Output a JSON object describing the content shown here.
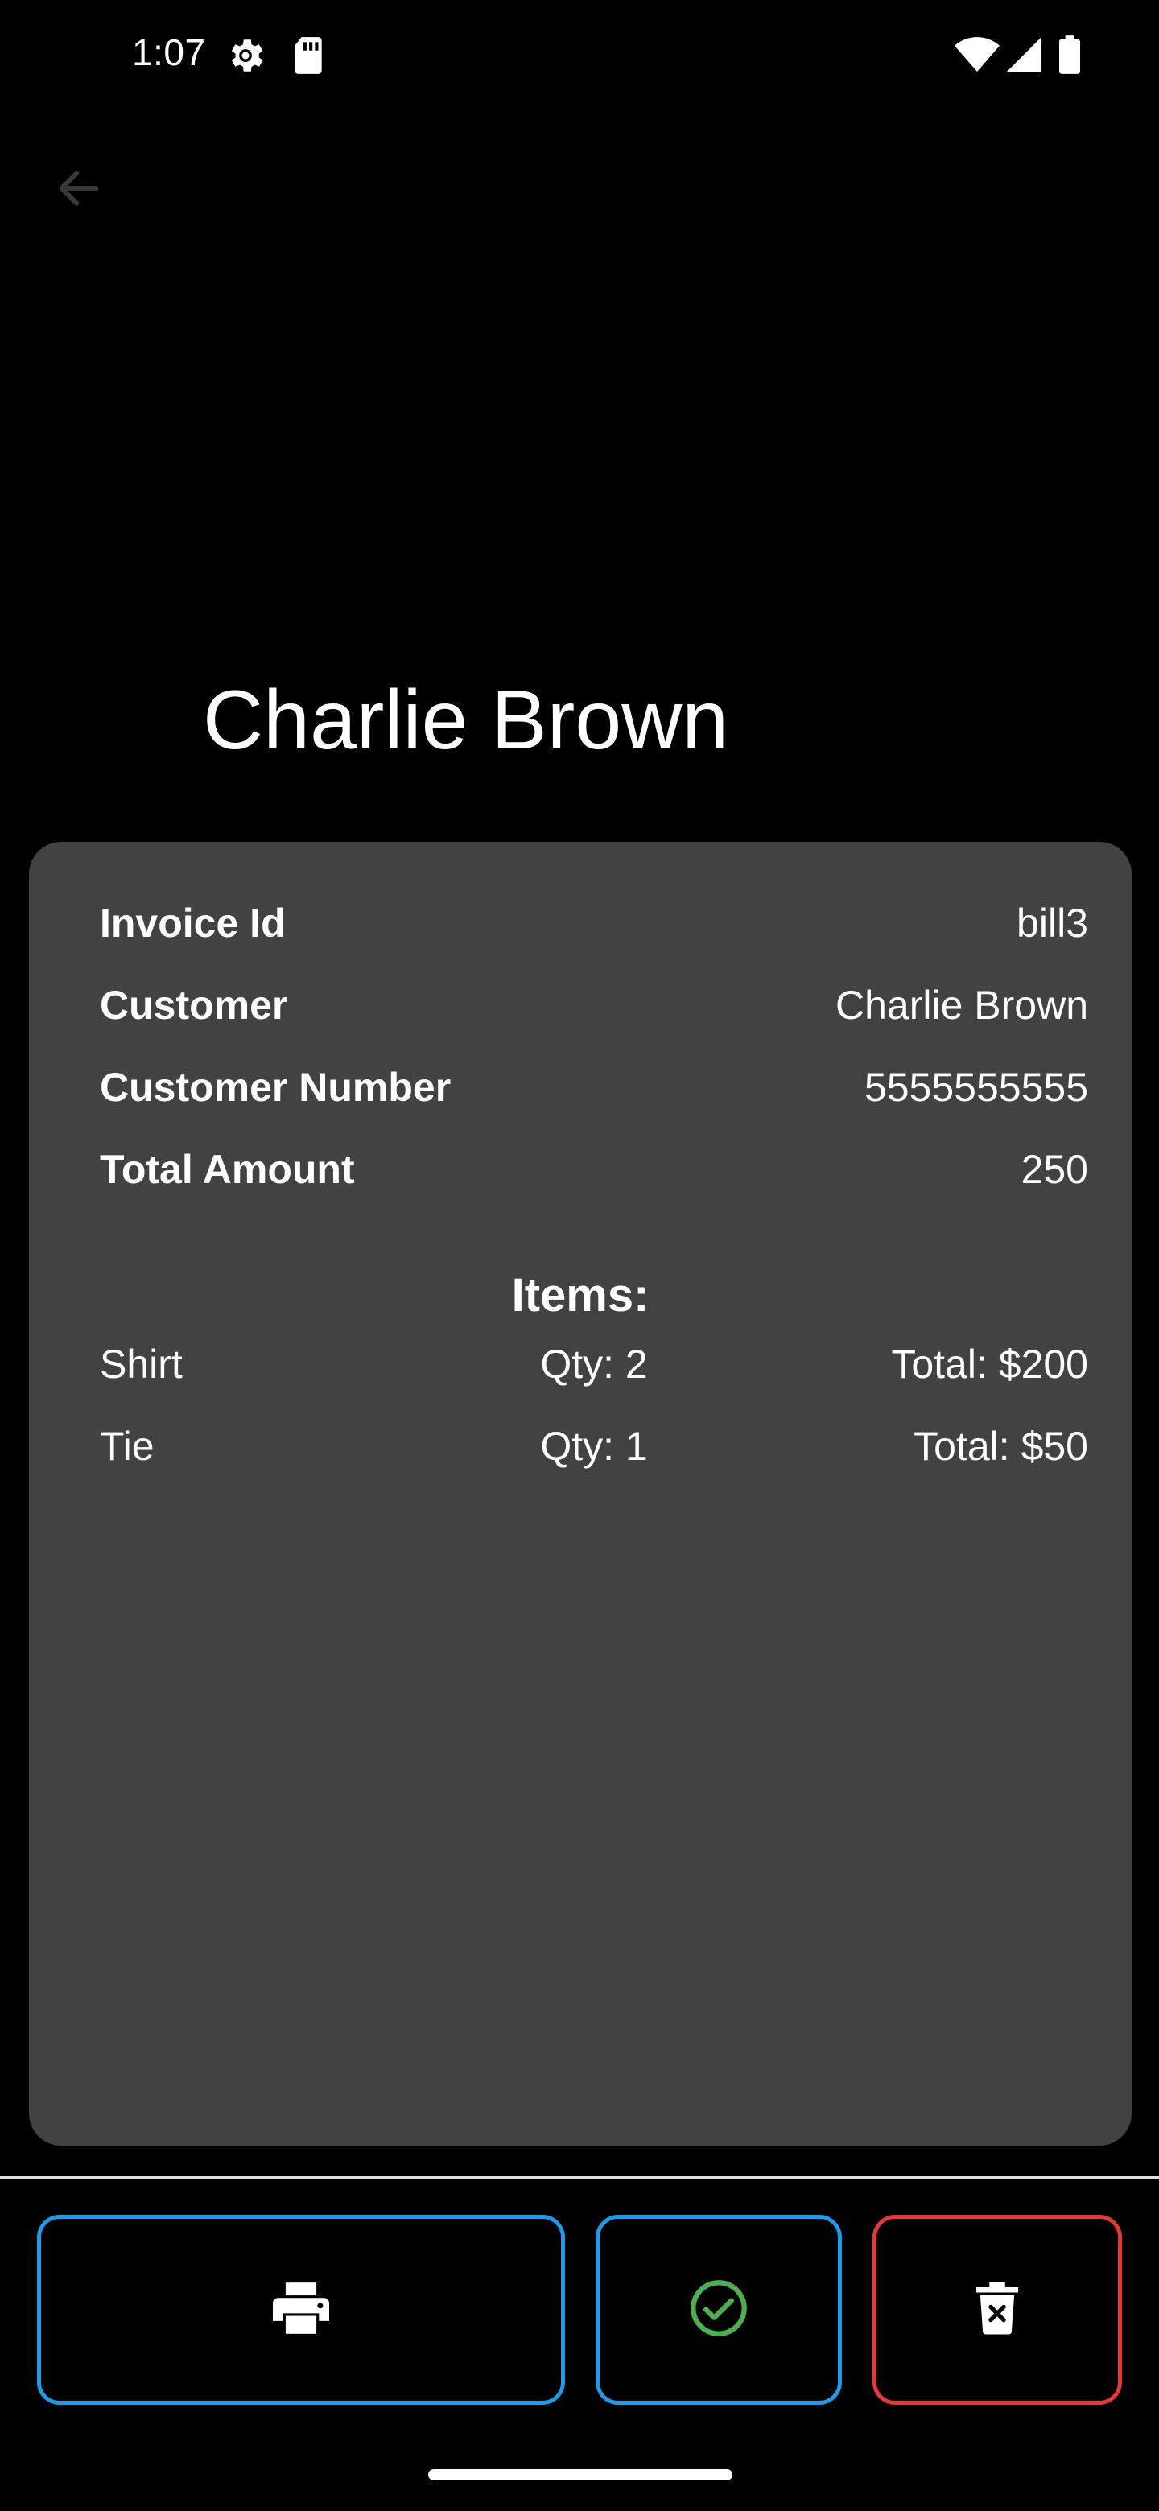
{
  "status_bar": {
    "time": "1:07"
  },
  "header": {
    "title": "Charlie Brown"
  },
  "invoice": {
    "details": [
      {
        "label": "Invoice Id",
        "value": "bill3"
      },
      {
        "label": "Customer",
        "value": "Charlie Brown"
      },
      {
        "label": "Customer Number",
        "value": "5555555555"
      },
      {
        "label": "Total Amount",
        "value": "250"
      }
    ],
    "items_heading": "Items:",
    "items": [
      {
        "name": "Shirt",
        "qty": "Qty: 2",
        "total": "Total: $200"
      },
      {
        "name": "Tie",
        "qty": "Qty: 1",
        "total": "Total: $50"
      }
    ]
  },
  "actions": {
    "print_icon": "printer-icon",
    "approve_icon": "check-circle-icon",
    "delete_icon": "trash-icon"
  },
  "colors": {
    "background": "#000000",
    "card": "#424242",
    "button_border_blue": "#1e9be8",
    "button_border_red": "#e53935",
    "approve_green": "#4caf50"
  }
}
